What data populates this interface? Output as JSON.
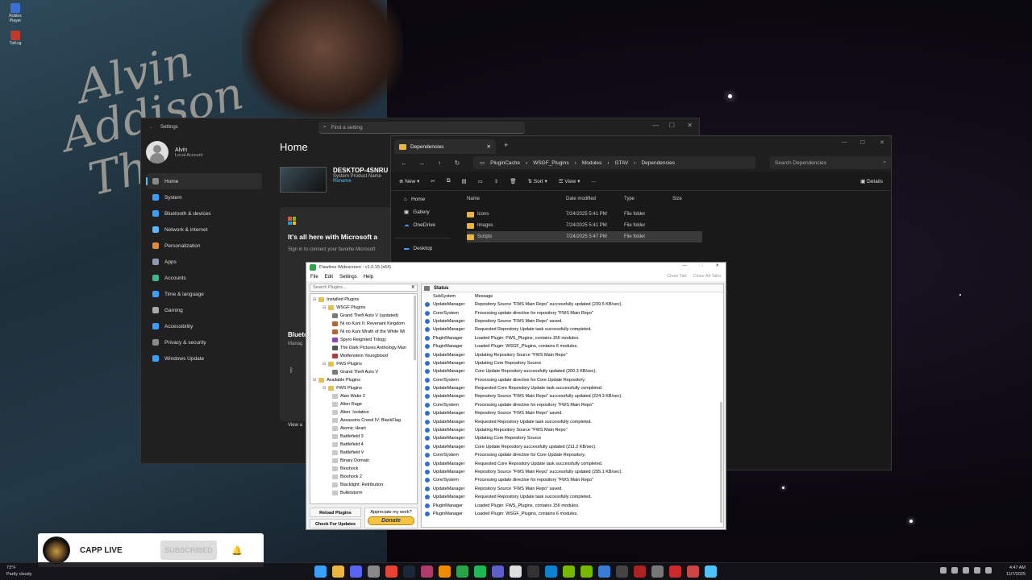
{
  "desktop": {
    "icons": [
      {
        "label": "Roblox Player"
      },
      {
        "label": "Tutl.cg"
      }
    ],
    "wallpaper_text": [
      "Alvin",
      "Addison",
      "Thr"
    ]
  },
  "settings": {
    "title": "Settings",
    "search_placeholder": "Find a setting",
    "user": {
      "name": "Alvin",
      "account": "Local Account"
    },
    "page_title": "Home",
    "nav": [
      {
        "label": "Home",
        "icon": "home-icon",
        "color": "#8a8a8a"
      },
      {
        "label": "System",
        "icon": "system-icon",
        "color": "#3aa0ff"
      },
      {
        "label": "Bluetooth & devices",
        "icon": "bluetooth-icon",
        "color": "#3aa0ff"
      },
      {
        "label": "Network & internet",
        "icon": "network-icon",
        "color": "#5fb7ff"
      },
      {
        "label": "Personalization",
        "icon": "personalization-icon",
        "color": "#e08a3a"
      },
      {
        "label": "Apps",
        "icon": "apps-icon",
        "color": "#8a9bb5"
      },
      {
        "label": "Accounts",
        "icon": "accounts-icon",
        "color": "#3fb68b"
      },
      {
        "label": "Time & language",
        "icon": "time-icon",
        "color": "#3aa0ff"
      },
      {
        "label": "Gaming",
        "icon": "gaming-icon",
        "color": "#aaaaaa"
      },
      {
        "label": "Accessibility",
        "icon": "accessibility-icon",
        "color": "#3aa0ff"
      },
      {
        "label": "Privacy & security",
        "icon": "shield-icon",
        "color": "#8a8a8a"
      },
      {
        "label": "Windows Update",
        "icon": "update-icon",
        "color": "#3aa0ff"
      }
    ],
    "device": {
      "name": "DESKTOP-4SNRU",
      "product": "System Product Name",
      "rename": "Rename"
    },
    "ms_card": {
      "heading": "It's all here with Microsoft a",
      "text": "Sign in to connect your favorite Microsoft"
    },
    "bt_card": {
      "heading": "Blueto",
      "text": "Manag",
      "view": "View a"
    }
  },
  "explorer": {
    "tab_title": "Dependencies",
    "breadcrumbs": [
      "PluginCache",
      "WSGF_Plugins",
      "Modules",
      "GTAV",
      "Dependencies"
    ],
    "search_placeholder": "Search Dependencies",
    "commands": {
      "new": "New",
      "sort": "Sort",
      "view": "View",
      "more": "...",
      "details": "Details"
    },
    "nav": [
      {
        "label": "Home"
      },
      {
        "label": "Gallery"
      },
      {
        "label": "OneDrive"
      },
      {
        "label": "Desktop"
      }
    ],
    "columns": [
      "Name",
      "Date modified",
      "Type",
      "Size"
    ],
    "rows": [
      {
        "name": "Icons",
        "date": "7/24/2025 5:41 PM",
        "type": "File folder"
      },
      {
        "name": "Images",
        "date": "7/24/2025 5:41 PM",
        "type": "File folder"
      },
      {
        "name": "Scripts",
        "date": "7/24/2025 5:47 PM",
        "type": "File folder"
      }
    ]
  },
  "flawless": {
    "title": "Flawless Widescreen - v1.0.15 (x64)",
    "menu": [
      "File",
      "Edit",
      "Settings",
      "Help"
    ],
    "close_tab": "Close Tab",
    "close_all_tabs": "Close All Tabs",
    "search_placeholder": "Search Plugins...",
    "search_clear": "X",
    "tree": [
      {
        "label": "Installed Plugins",
        "indent": 0,
        "color": "#e8c14a"
      },
      {
        "label": "WSGF Plugins",
        "indent": 1,
        "color": "#e8c14a"
      },
      {
        "label": "Grand Theft Auto V (updated)",
        "indent": 2,
        "color": "#7a7a7a"
      },
      {
        "label": "Ni no Kuni II: Revenant Kingdom",
        "indent": 2,
        "color": "#b5643a"
      },
      {
        "label": "Ni no Kuni Wrath of the White Wi",
        "indent": 2,
        "color": "#b5643a"
      },
      {
        "label": "Spyro Reignited Trilogy",
        "indent": 2,
        "color": "#8a4ab5"
      },
      {
        "label": "The Dark Pictures Anthology Man",
        "indent": 2,
        "color": "#555555"
      },
      {
        "label": "Wolfenstein Youngblood",
        "indent": 2,
        "color": "#b53a3a"
      },
      {
        "label": "FWS Plugins",
        "indent": 1,
        "color": "#e8c14a"
      },
      {
        "label": "Grand Theft Auto V",
        "indent": 2,
        "color": "#7a7a7a"
      },
      {
        "label": "Available Plugins",
        "indent": 0,
        "color": "#e8c14a"
      },
      {
        "label": "FWS Plugins",
        "indent": 1,
        "color": "#e8c14a"
      },
      {
        "label": "Alan Wake 2",
        "indent": 2,
        "color": "#c8c8c8"
      },
      {
        "label": "Alien Rage",
        "indent": 2,
        "color": "#c8c8c8"
      },
      {
        "label": "Alien: Isolation",
        "indent": 2,
        "color": "#c8c8c8"
      },
      {
        "label": "Assassins Creed IV: BlackFlag",
        "indent": 2,
        "color": "#c8c8c8"
      },
      {
        "label": "Atomic Heart",
        "indent": 2,
        "color": "#c8c8c8"
      },
      {
        "label": "Battlefield 3",
        "indent": 2,
        "color": "#c8c8c8"
      },
      {
        "label": "Battlefield 4",
        "indent": 2,
        "color": "#c8c8c8"
      },
      {
        "label": "Battlefield V",
        "indent": 2,
        "color": "#c8c8c8"
      },
      {
        "label": "Binary Domain",
        "indent": 2,
        "color": "#c8c8c8"
      },
      {
        "label": "Bioshock",
        "indent": 2,
        "color": "#c8c8c8"
      },
      {
        "label": "Bioshock 2",
        "indent": 2,
        "color": "#c8c8c8"
      },
      {
        "label": "Blacklight: Retribution",
        "indent": 2,
        "color": "#c8c8c8"
      },
      {
        "label": "Bulletstorm",
        "indent": 2,
        "color": "#c8c8c8"
      }
    ],
    "buttons": {
      "reload": "Reload Plugins",
      "check": "Check For Updates",
      "appreciate": "Appreciate my work?",
      "donate": "Donate"
    },
    "status_header": "Status",
    "log_columns": [
      "SubSystem",
      "Message"
    ],
    "log": [
      {
        "s": "UpdateManager",
        "m": "Repository Source \"FWS Main Repo\" successfully updated (239.5 KB/sec)."
      },
      {
        "s": "Core/System",
        "m": "Processing update directive for repository \"FWS Main Repo\""
      },
      {
        "s": "UpdateManager",
        "m": "Repository Source \"FWS Main Repo\" saved."
      },
      {
        "s": "UpdateManager",
        "m": "Requested Repository Update task successfully completed."
      },
      {
        "s": "PluginManager",
        "m": "Loaded Plugin: FWS_Plugins, contains 156 modules."
      },
      {
        "s": "PluginManager",
        "m": "Loaded Plugin: WSGF_Plugins, contains 6 modules."
      },
      {
        "s": "UpdateManager",
        "m": "Updating Repository Source \"FWS Main Repo\""
      },
      {
        "s": "UpdateManager",
        "m": "Updating Core Repository Source"
      },
      {
        "s": "UpdateManager",
        "m": "Core Update Repository successfully updated (200.3 KB/sec)."
      },
      {
        "s": "Core/System",
        "m": "Processing update directive for Core Update Repository."
      },
      {
        "s": "UpdateManager",
        "m": "Requested Core Repository Update task successfully completed."
      },
      {
        "s": "UpdateManager",
        "m": "Repository Source \"FWS Main Repo\" successfully updated (224.3 KB/sec)."
      },
      {
        "s": "Core/System",
        "m": "Processing update directive for repository \"FWS Main Repo\""
      },
      {
        "s": "UpdateManager",
        "m": "Repository Source \"FWS Main Repo\" saved."
      },
      {
        "s": "UpdateManager",
        "m": "Requested Repository Update task successfully completed."
      },
      {
        "s": "UpdateManager",
        "m": "Updating Repository Source \"FWS Main Repo\""
      },
      {
        "s": "UpdateManager",
        "m": "Updating Core Repository Source"
      },
      {
        "s": "UpdateManager",
        "m": "Core Update Repository successfully updated (211.2 KB/sec)."
      },
      {
        "s": "Core/System",
        "m": "Processing update directive for Core Update Repository."
      },
      {
        "s": "UpdateManager",
        "m": "Requested Core Repository Update task successfully completed."
      },
      {
        "s": "UpdateManager",
        "m": "Repository Source \"FWS Main Repo\" successfully updated (295.1 KB/sec)."
      },
      {
        "s": "Core/System",
        "m": "Processing update directive for repository \"FWS Main Repo\""
      },
      {
        "s": "UpdateManager",
        "m": "Repository Source \"FWS Main Repo\" saved."
      },
      {
        "s": "UpdateManager",
        "m": "Requested Repository Update task successfully completed."
      },
      {
        "s": "PluginManager",
        "m": "Loaded Plugin: FWS_Plugins, contains 156 modules."
      },
      {
        "s": "PluginManager",
        "m": "Loaded Plugin: WSGF_Plugins, contains 6 modules."
      }
    ]
  },
  "youtube": {
    "channel": "CAPP LIVE",
    "subscribe": "SUBSCRIBED"
  },
  "taskbar": {
    "weather_temp": "73°F",
    "weather_desc": "Partly cloudy",
    "time": "4:47 AM",
    "date": "11/7/2025",
    "apps": [
      {
        "icon": "start-icon",
        "color": "#3aa0ff"
      },
      {
        "icon": "file-explorer-icon",
        "color": "#e9b53f"
      },
      {
        "icon": "discord-icon",
        "color": "#5865f2"
      },
      {
        "icon": "settings-icon",
        "color": "#888888"
      },
      {
        "icon": "chrome-icon",
        "color": "#e94235"
      },
      {
        "icon": "steam-icon",
        "color": "#1b2838"
      },
      {
        "icon": "xbox-icon",
        "color": "#b03a6a"
      },
      {
        "icon": "vlc-icon",
        "color": "#f08a00"
      },
      {
        "icon": "flawless-icon",
        "color": "#2aa34a"
      },
      {
        "icon": "spotify-icon",
        "color": "#1db954"
      },
      {
        "icon": "teams-icon",
        "color": "#5b5fc7"
      },
      {
        "icon": "app-icon",
        "color": "#dddddd"
      },
      {
        "icon": "epic-icon",
        "color": "#333333"
      },
      {
        "icon": "edge-icon",
        "color": "#0a84d0"
      },
      {
        "icon": "green-app-icon",
        "color": "#76b900"
      },
      {
        "icon": "nvidia-icon",
        "color": "#76b900"
      },
      {
        "icon": "browser-icon",
        "color": "#3a7bd5"
      },
      {
        "icon": "app2-icon",
        "color": "#444444"
      },
      {
        "icon": "app3-icon",
        "color": "#aa2222"
      },
      {
        "icon": "app4-icon",
        "color": "#777777"
      },
      {
        "icon": "amd-icon",
        "color": "#cc2a2a"
      },
      {
        "icon": "app5-icon",
        "color": "#cc4444"
      },
      {
        "icon": "notepad-icon",
        "color": "#4fc3f7"
      }
    ]
  }
}
